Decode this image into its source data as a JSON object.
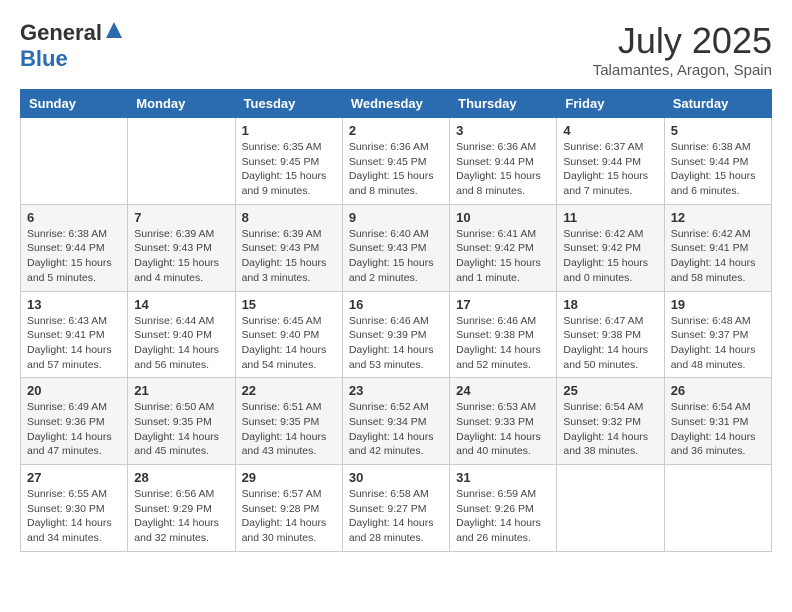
{
  "header": {
    "logo_general": "General",
    "logo_blue": "Blue",
    "month": "July 2025",
    "location": "Talamantes, Aragon, Spain"
  },
  "weekdays": [
    "Sunday",
    "Monday",
    "Tuesday",
    "Wednesday",
    "Thursday",
    "Friday",
    "Saturday"
  ],
  "weeks": [
    [
      null,
      null,
      {
        "day": "1",
        "sunrise": "6:35 AM",
        "sunset": "9:45 PM",
        "daylight": "15 hours and 9 minutes."
      },
      {
        "day": "2",
        "sunrise": "6:36 AM",
        "sunset": "9:45 PM",
        "daylight": "15 hours and 8 minutes."
      },
      {
        "day": "3",
        "sunrise": "6:36 AM",
        "sunset": "9:44 PM",
        "daylight": "15 hours and 8 minutes."
      },
      {
        "day": "4",
        "sunrise": "6:37 AM",
        "sunset": "9:44 PM",
        "daylight": "15 hours and 7 minutes."
      },
      {
        "day": "5",
        "sunrise": "6:38 AM",
        "sunset": "9:44 PM",
        "daylight": "15 hours and 6 minutes."
      }
    ],
    [
      {
        "day": "6",
        "sunrise": "6:38 AM",
        "sunset": "9:44 PM",
        "daylight": "15 hours and 5 minutes."
      },
      {
        "day": "7",
        "sunrise": "6:39 AM",
        "sunset": "9:43 PM",
        "daylight": "15 hours and 4 minutes."
      },
      {
        "day": "8",
        "sunrise": "6:39 AM",
        "sunset": "9:43 PM",
        "daylight": "15 hours and 3 minutes."
      },
      {
        "day": "9",
        "sunrise": "6:40 AM",
        "sunset": "9:43 PM",
        "daylight": "15 hours and 2 minutes."
      },
      {
        "day": "10",
        "sunrise": "6:41 AM",
        "sunset": "9:42 PM",
        "daylight": "15 hours and 1 minute."
      },
      {
        "day": "11",
        "sunrise": "6:42 AM",
        "sunset": "9:42 PM",
        "daylight": "15 hours and 0 minutes."
      },
      {
        "day": "12",
        "sunrise": "6:42 AM",
        "sunset": "9:41 PM",
        "daylight": "14 hours and 58 minutes."
      }
    ],
    [
      {
        "day": "13",
        "sunrise": "6:43 AM",
        "sunset": "9:41 PM",
        "daylight": "14 hours and 57 minutes."
      },
      {
        "day": "14",
        "sunrise": "6:44 AM",
        "sunset": "9:40 PM",
        "daylight": "14 hours and 56 minutes."
      },
      {
        "day": "15",
        "sunrise": "6:45 AM",
        "sunset": "9:40 PM",
        "daylight": "14 hours and 54 minutes."
      },
      {
        "day": "16",
        "sunrise": "6:46 AM",
        "sunset": "9:39 PM",
        "daylight": "14 hours and 53 minutes."
      },
      {
        "day": "17",
        "sunrise": "6:46 AM",
        "sunset": "9:38 PM",
        "daylight": "14 hours and 52 minutes."
      },
      {
        "day": "18",
        "sunrise": "6:47 AM",
        "sunset": "9:38 PM",
        "daylight": "14 hours and 50 minutes."
      },
      {
        "day": "19",
        "sunrise": "6:48 AM",
        "sunset": "9:37 PM",
        "daylight": "14 hours and 48 minutes."
      }
    ],
    [
      {
        "day": "20",
        "sunrise": "6:49 AM",
        "sunset": "9:36 PM",
        "daylight": "14 hours and 47 minutes."
      },
      {
        "day": "21",
        "sunrise": "6:50 AM",
        "sunset": "9:35 PM",
        "daylight": "14 hours and 45 minutes."
      },
      {
        "day": "22",
        "sunrise": "6:51 AM",
        "sunset": "9:35 PM",
        "daylight": "14 hours and 43 minutes."
      },
      {
        "day": "23",
        "sunrise": "6:52 AM",
        "sunset": "9:34 PM",
        "daylight": "14 hours and 42 minutes."
      },
      {
        "day": "24",
        "sunrise": "6:53 AM",
        "sunset": "9:33 PM",
        "daylight": "14 hours and 40 minutes."
      },
      {
        "day": "25",
        "sunrise": "6:54 AM",
        "sunset": "9:32 PM",
        "daylight": "14 hours and 38 minutes."
      },
      {
        "day": "26",
        "sunrise": "6:54 AM",
        "sunset": "9:31 PM",
        "daylight": "14 hours and 36 minutes."
      }
    ],
    [
      {
        "day": "27",
        "sunrise": "6:55 AM",
        "sunset": "9:30 PM",
        "daylight": "14 hours and 34 minutes."
      },
      {
        "day": "28",
        "sunrise": "6:56 AM",
        "sunset": "9:29 PM",
        "daylight": "14 hours and 32 minutes."
      },
      {
        "day": "29",
        "sunrise": "6:57 AM",
        "sunset": "9:28 PM",
        "daylight": "14 hours and 30 minutes."
      },
      {
        "day": "30",
        "sunrise": "6:58 AM",
        "sunset": "9:27 PM",
        "daylight": "14 hours and 28 minutes."
      },
      {
        "day": "31",
        "sunrise": "6:59 AM",
        "sunset": "9:26 PM",
        "daylight": "14 hours and 26 minutes."
      },
      null,
      null
    ]
  ]
}
